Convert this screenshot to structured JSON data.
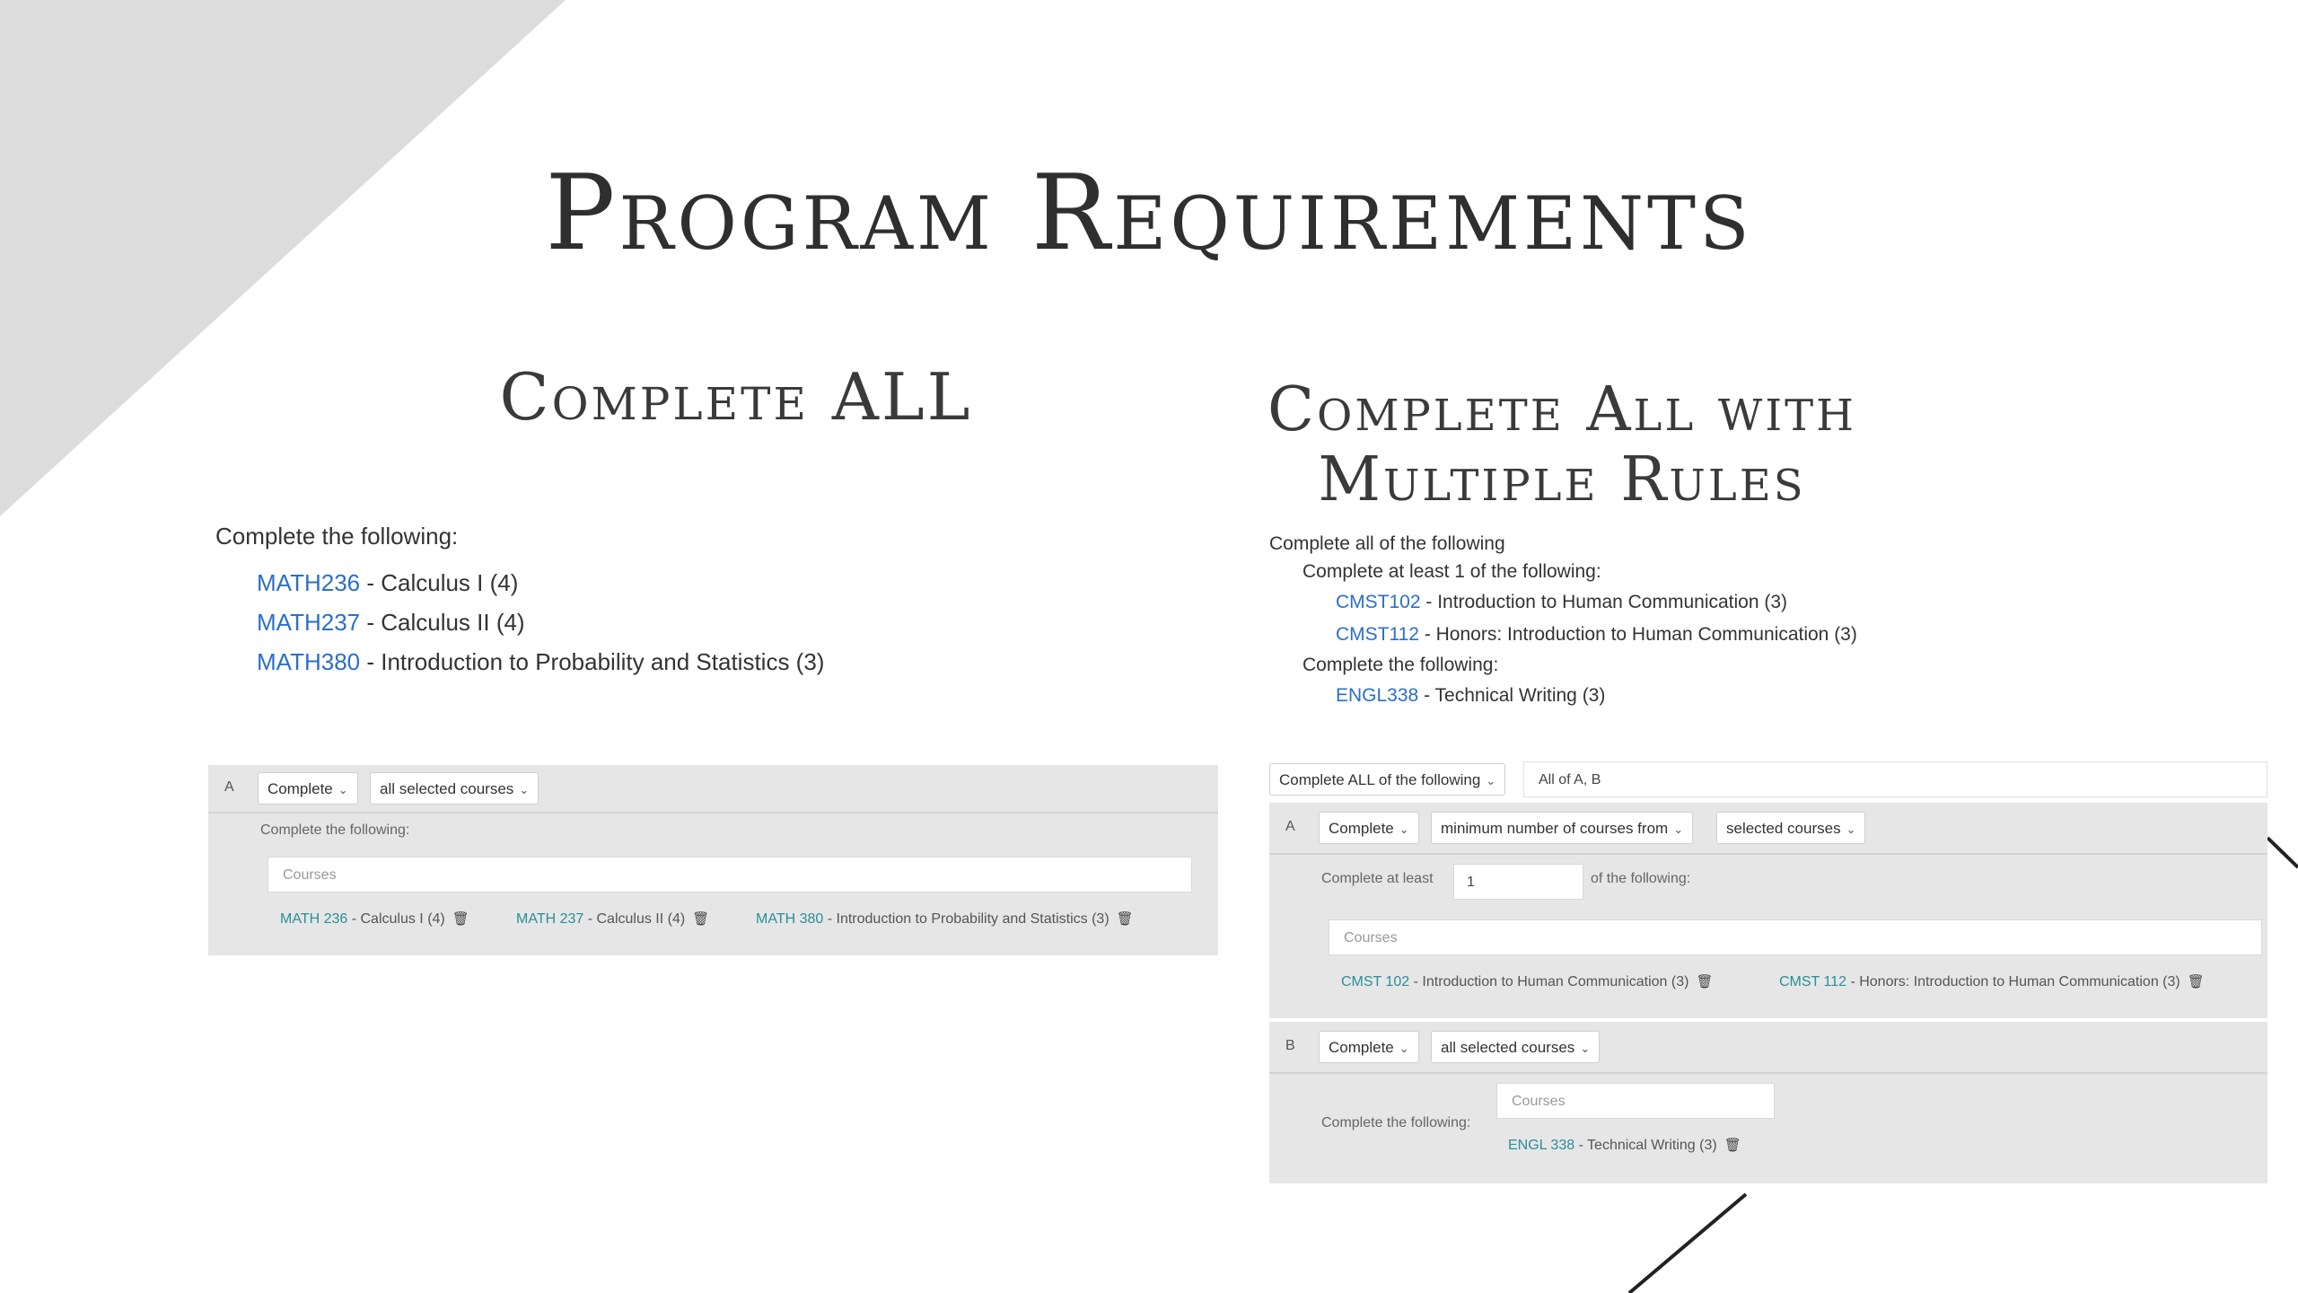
{
  "title": "Program Requirements",
  "left": {
    "subtitle": "Complete ALL",
    "intro": "Complete the following:",
    "courses": [
      {
        "code": "MATH236",
        "name": " - Calculus I  (4)"
      },
      {
        "code": "MATH237",
        "name": " - Calculus II  (4)"
      },
      {
        "code": "MATH380",
        "name": " - Introduction to Probability and Statistics  (3)"
      }
    ],
    "editor": {
      "letter": "A",
      "rule_select": "Complete",
      "scope_select": "all selected courses",
      "instruction": "Complete the following:",
      "courses_placeholder": "Courses",
      "chips": [
        {
          "code": "MATH 236",
          "name": " - Calculus I  (4)"
        },
        {
          "code": "MATH 237",
          "name": " - Calculus II  (4)"
        },
        {
          "code": "MATH 380",
          "name": " - Introduction to Probability and Statistics  (3)"
        }
      ]
    }
  },
  "right": {
    "subtitle_line1": "Complete All with",
    "subtitle_line2": "Multiple Rules",
    "list": {
      "root": "Complete all of the following",
      "rule_a": "Complete at least 1 of the following:",
      "rule_a_courses": [
        {
          "code": "CMST102",
          "name": " - Introduction to Human Communication  (3)"
        },
        {
          "code": "CMST112",
          "name": " - Honors: Introduction to Human Communication  (3)"
        }
      ],
      "rule_b": "Complete the following:",
      "rule_b_courses": [
        {
          "code": "ENGL338",
          "name": " - Technical Writing  (3)"
        }
      ]
    },
    "editor": {
      "top_select": "Complete ALL of the following",
      "top_value": "All of A, B",
      "a": {
        "letter": "A",
        "rule_select": "Complete",
        "mode_select": "minimum number of courses from",
        "scope_select": "selected courses",
        "atleast_label": "Complete at least",
        "atleast_value": "1",
        "following_label": "of the following:",
        "courses_placeholder": "Courses",
        "chips": [
          {
            "code": "CMST 102",
            "name": " - Introduction to Human Communication  (3)"
          },
          {
            "code": "CMST 112",
            "name": " - Honors: Introduction to Human Communication  (3)"
          }
        ]
      },
      "b": {
        "letter": "B",
        "rule_select": "Complete",
        "scope_select": "all selected courses",
        "instruction": "Complete the following:",
        "courses_placeholder": "Courses",
        "chips": [
          {
            "code": "ENGL 338",
            "name": " - Technical Writing  (3)"
          }
        ]
      }
    }
  },
  "icons": {
    "trash": "trash-icon",
    "chevron": "chevron-down-icon"
  },
  "colors": {
    "link": "#2a6fc9",
    "chip_link": "#2a8f9a",
    "panel": "#e6e6e6",
    "corner": "#dcdcdc"
  }
}
